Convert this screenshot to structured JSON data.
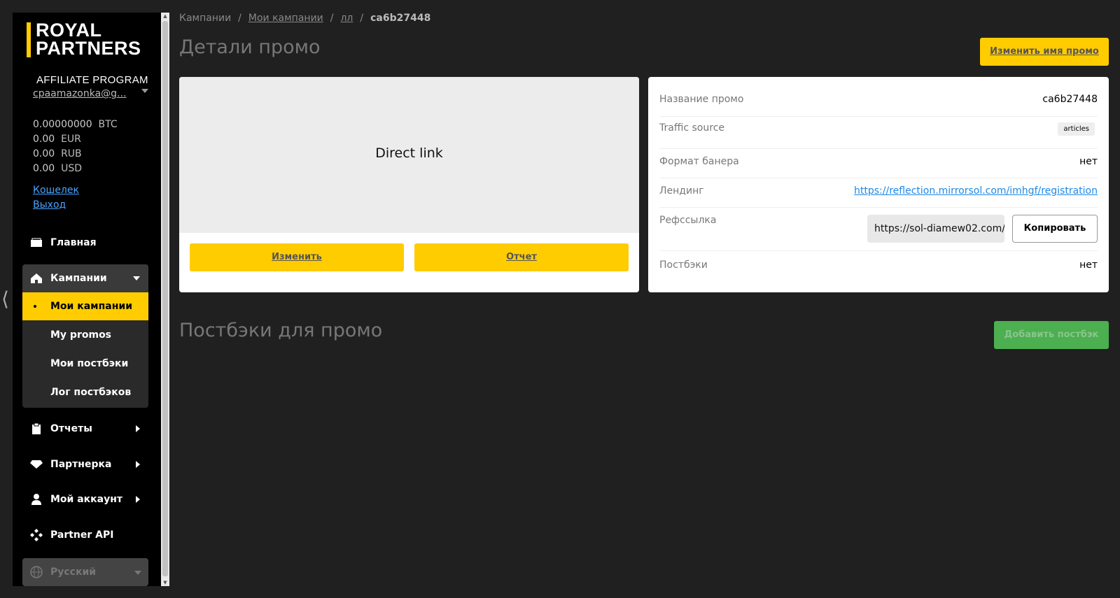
{
  "sidebar": {
    "logo": {
      "line1": "ROYAL",
      "line2": "PARTNERS",
      "line3": "AFFILIATE PROGRAM"
    },
    "user_email": "cpaamazonka@g...",
    "balances": [
      {
        "amount": "0.00000000",
        "currency": "BTC"
      },
      {
        "amount": "0.00",
        "currency": "EUR"
      },
      {
        "amount": "0.00",
        "currency": "RUB"
      },
      {
        "amount": "0.00",
        "currency": "USD"
      }
    ],
    "wallet_link": "Кошелек",
    "logout_link": "Выход",
    "nav": {
      "home": "Главная",
      "campaigns": "Кампании",
      "campaigns_sub": [
        "Мои кампании",
        "My promos",
        "Мои постбэки",
        "Лог постбэков"
      ],
      "reports": "Отчеты",
      "partner": "Партнерка",
      "account": "Мой аккаунт",
      "api": "Partner API",
      "language": "Русский"
    }
  },
  "breadcrumb": {
    "items": [
      "Кампании",
      "Мои кампании",
      "лл"
    ],
    "current": "ca6b27448"
  },
  "page_title": "Детали промо",
  "rename_button": "Изменить имя промо",
  "preview": {
    "label": "Direct link",
    "edit_button": "Изменить",
    "report_button": "Отчет"
  },
  "details": {
    "promo_name_label": "Название промо",
    "promo_name": "ca6b27448",
    "traffic_source_label": "Traffic source",
    "traffic_source": "articles",
    "banner_format_label": "Формат банера",
    "banner_format": "нет",
    "landing_label": "Лендинг",
    "landing_url": "https://reflection.mirrorsol.com/imhgf/registration",
    "reflink_label": "Рефссылка",
    "reflink": "https://sol-diamew02.com/...",
    "copy_button": "Копировать",
    "postbacks_label": "Постбэки",
    "postbacks": "нет"
  },
  "postbacks_title": "Постбэки для промо",
  "add_postback_button": "Добавить постбэк",
  "colors": {
    "accent": "#ffcc00",
    "green": "#4caf50",
    "background": "#202020"
  }
}
